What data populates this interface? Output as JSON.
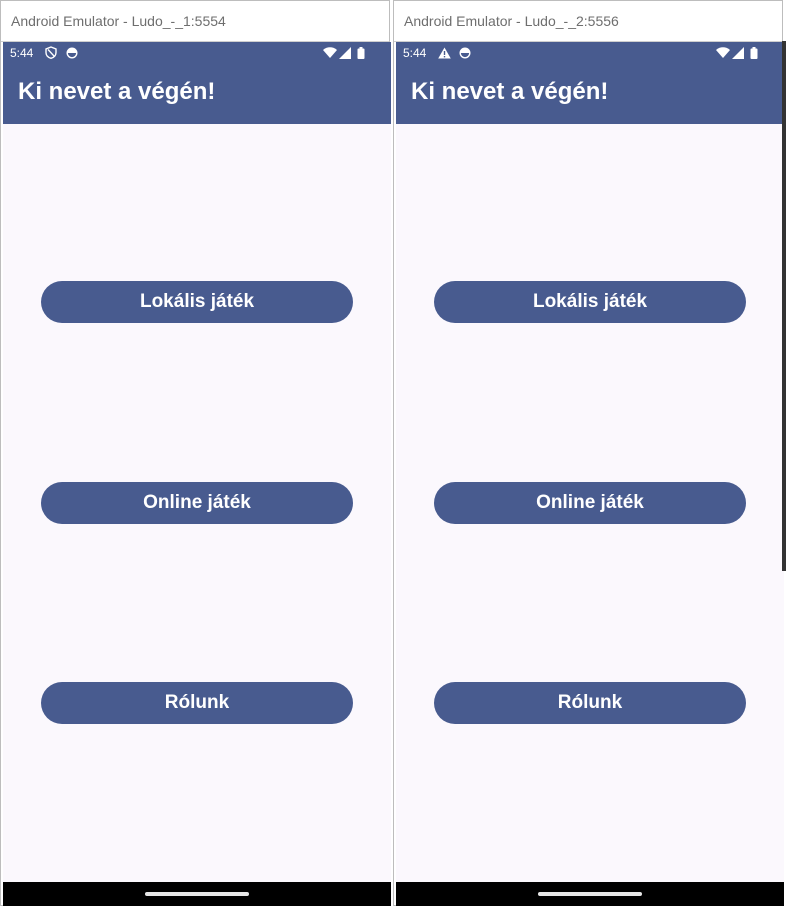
{
  "colors": {
    "app_primary": "#485b8f",
    "background": "#fbf8fd",
    "on_primary": "#ffffff"
  },
  "emulators": [
    {
      "window_title": "Android Emulator - Ludo_-_1:5554",
      "status": {
        "time": "5:44",
        "left_icons": [
          "shield-icon",
          "sync-circle-icon"
        ],
        "right_icons": [
          "wifi-icon",
          "signal-icon",
          "battery-icon"
        ]
      },
      "app_title": "Ki nevet a végén!",
      "buttons": {
        "local": "Lokális játék",
        "online": "Online játék",
        "about": "Rólunk"
      }
    },
    {
      "window_title": "Android Emulator - Ludo_-_2:5556",
      "status": {
        "time": "5:44",
        "left_icons": [
          "warning-icon",
          "sync-circle-icon"
        ],
        "right_icons": [
          "wifi-icon",
          "signal-icon",
          "battery-icon"
        ]
      },
      "app_title": "Ki nevet a végén!",
      "buttons": {
        "local": "Lokális játék",
        "online": "Online játék",
        "about": "Rólunk"
      }
    }
  ]
}
